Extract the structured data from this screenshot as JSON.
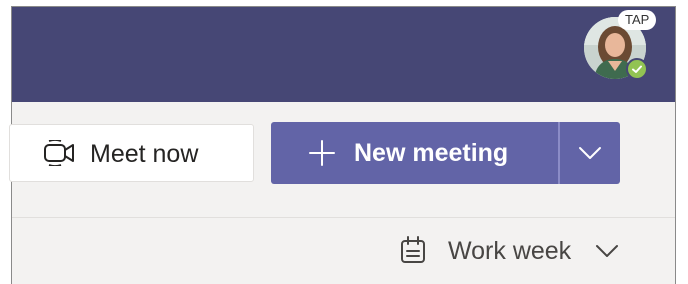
{
  "profile": {
    "badge_text": "TAP",
    "presence": "available"
  },
  "toolbar": {
    "meet_now_label": "Meet now",
    "new_meeting_label": "New meeting",
    "view_label": "Work week"
  },
  "colors": {
    "title_bar": "#464775",
    "brand_purple": "#6264a7",
    "presence_green": "#92c353",
    "toolbar_bg": "#f3f2f1"
  },
  "icons": {
    "meet_now": "video-camera-icon",
    "new_meeting": "plus-icon",
    "dropdown": "chevron-down-icon",
    "view": "calendar-icon"
  }
}
